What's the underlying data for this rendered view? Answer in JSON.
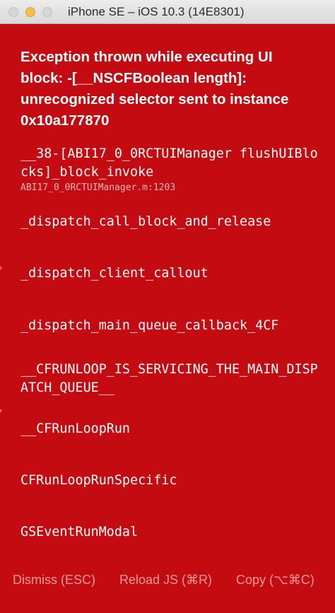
{
  "window": {
    "title": "iPhone SE – iOS 10.3 (14E8301)",
    "background_color": "#c50b12"
  },
  "error": {
    "message": "Exception thrown while executing UI block: -[__NSCFBoolean length]: unrecognized selector sent to instance 0x10a177870"
  },
  "stack": [
    {
      "method": "__38-[ABI17_0_0RCTUIManager flushUIBlocks]_block_invoke",
      "file": "ABI17_0_0RCTUIManager.m:1203"
    },
    {
      "method": "_dispatch_call_block_and_release",
      "file": ""
    },
    {
      "method": "_dispatch_client_callout",
      "file": ""
    },
    {
      "method": "_dispatch_main_queue_callback_4CF",
      "file": ""
    },
    {
      "method": "__CFRUNLOOP_IS_SERVICING_THE_MAIN_DISPATCH_QUEUE__",
      "file": ""
    },
    {
      "method": "__CFRunLoopRun",
      "file": ""
    },
    {
      "method": "CFRunLoopRunSpecific",
      "file": ""
    },
    {
      "method": "GSEventRunModal",
      "file": ""
    }
  ],
  "buttons": {
    "dismiss": "Dismiss (ESC)",
    "reload": "Reload JS (⌘R)",
    "copy": "Copy (⌥⌘C)"
  },
  "edge_glyph": "›"
}
